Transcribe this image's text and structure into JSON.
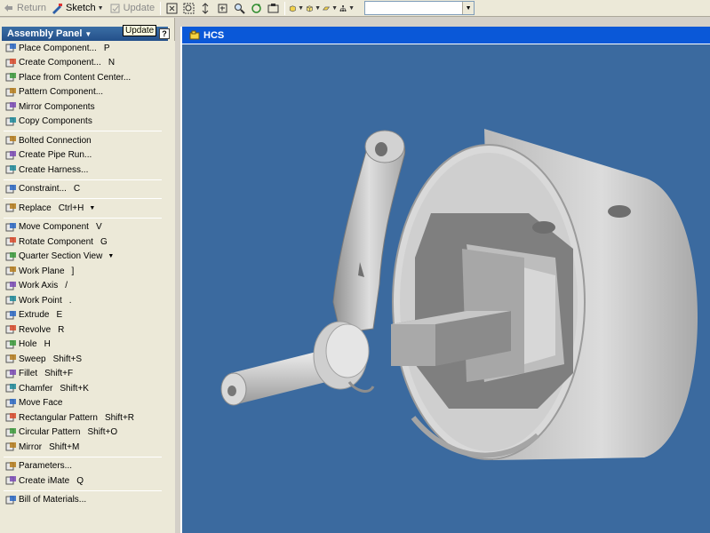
{
  "toolbar": {
    "return_label": "Return",
    "sketch_label": "Sketch",
    "update_label": "Update",
    "combo_value": ""
  },
  "panel": {
    "title": "Assembly Panel",
    "update_tooltip": "Update",
    "help_label": "?",
    "groups": [
      [
        {
          "label": "Place Component...",
          "shortcut": "P",
          "icon": "place-component-icon"
        },
        {
          "label": "Create Component...",
          "shortcut": "N",
          "icon": "create-component-icon"
        },
        {
          "label": "Place from Content Center...",
          "shortcut": "",
          "icon": "content-center-icon"
        },
        {
          "label": "Pattern Component...",
          "shortcut": "",
          "icon": "pattern-component-icon"
        },
        {
          "label": "Mirror Components",
          "shortcut": "",
          "icon": "mirror-components-icon"
        },
        {
          "label": "Copy Components",
          "shortcut": "",
          "icon": "copy-components-icon"
        }
      ],
      [
        {
          "label": "Bolted Connection",
          "shortcut": "",
          "icon": "bolted-connection-icon"
        },
        {
          "label": "Create Pipe Run...",
          "shortcut": "",
          "icon": "pipe-run-icon"
        },
        {
          "label": "Create Harness...",
          "shortcut": "",
          "icon": "harness-icon"
        }
      ],
      [
        {
          "label": "Constraint...",
          "shortcut": "C",
          "icon": "constraint-icon"
        }
      ],
      [
        {
          "label": "Replace",
          "shortcut": "Ctrl+H",
          "icon": "replace-icon",
          "caret": true
        }
      ],
      [
        {
          "label": "Move Component",
          "shortcut": "V",
          "icon": "move-component-icon"
        },
        {
          "label": "Rotate Component",
          "shortcut": "G",
          "icon": "rotate-component-icon"
        },
        {
          "label": "Quarter Section View",
          "shortcut": "",
          "icon": "section-view-icon",
          "caret": true
        },
        {
          "label": "Work Plane",
          "shortcut": "]",
          "icon": "work-plane-icon"
        },
        {
          "label": "Work Axis",
          "shortcut": "/",
          "icon": "work-axis-icon"
        },
        {
          "label": "Work Point",
          "shortcut": ".",
          "icon": "work-point-icon"
        },
        {
          "label": "Extrude",
          "shortcut": "E",
          "icon": "extrude-icon"
        },
        {
          "label": "Revolve",
          "shortcut": "R",
          "icon": "revolve-icon"
        },
        {
          "label": "Hole",
          "shortcut": "H",
          "icon": "hole-icon"
        },
        {
          "label": "Sweep",
          "shortcut": "Shift+S",
          "icon": "sweep-icon"
        },
        {
          "label": "Fillet",
          "shortcut": "Shift+F",
          "icon": "fillet-icon"
        },
        {
          "label": "Chamfer",
          "shortcut": "Shift+K",
          "icon": "chamfer-icon"
        },
        {
          "label": "Move Face",
          "shortcut": "",
          "icon": "move-face-icon"
        },
        {
          "label": "Rectangular Pattern",
          "shortcut": "Shift+R",
          "icon": "rectangular-pattern-icon"
        },
        {
          "label": "Circular Pattern",
          "shortcut": "Shift+O",
          "icon": "circular-pattern-icon"
        },
        {
          "label": "Mirror",
          "shortcut": "Shift+M",
          "icon": "mirror-icon"
        }
      ],
      [
        {
          "label": "Parameters...",
          "shortcut": "",
          "icon": "parameters-icon"
        },
        {
          "label": "Create iMate",
          "shortcut": "Q",
          "icon": "imate-icon"
        }
      ],
      [
        {
          "label": "Bill of Materials...",
          "shortcut": "",
          "icon": "bill-of-materials-icon"
        }
      ]
    ]
  },
  "viewport": {
    "title": "HCS"
  },
  "colors": {
    "viewport_bg": "#3b6a9f",
    "title_bar": "#0a58d8",
    "panel_header": "#3a6ea5"
  }
}
